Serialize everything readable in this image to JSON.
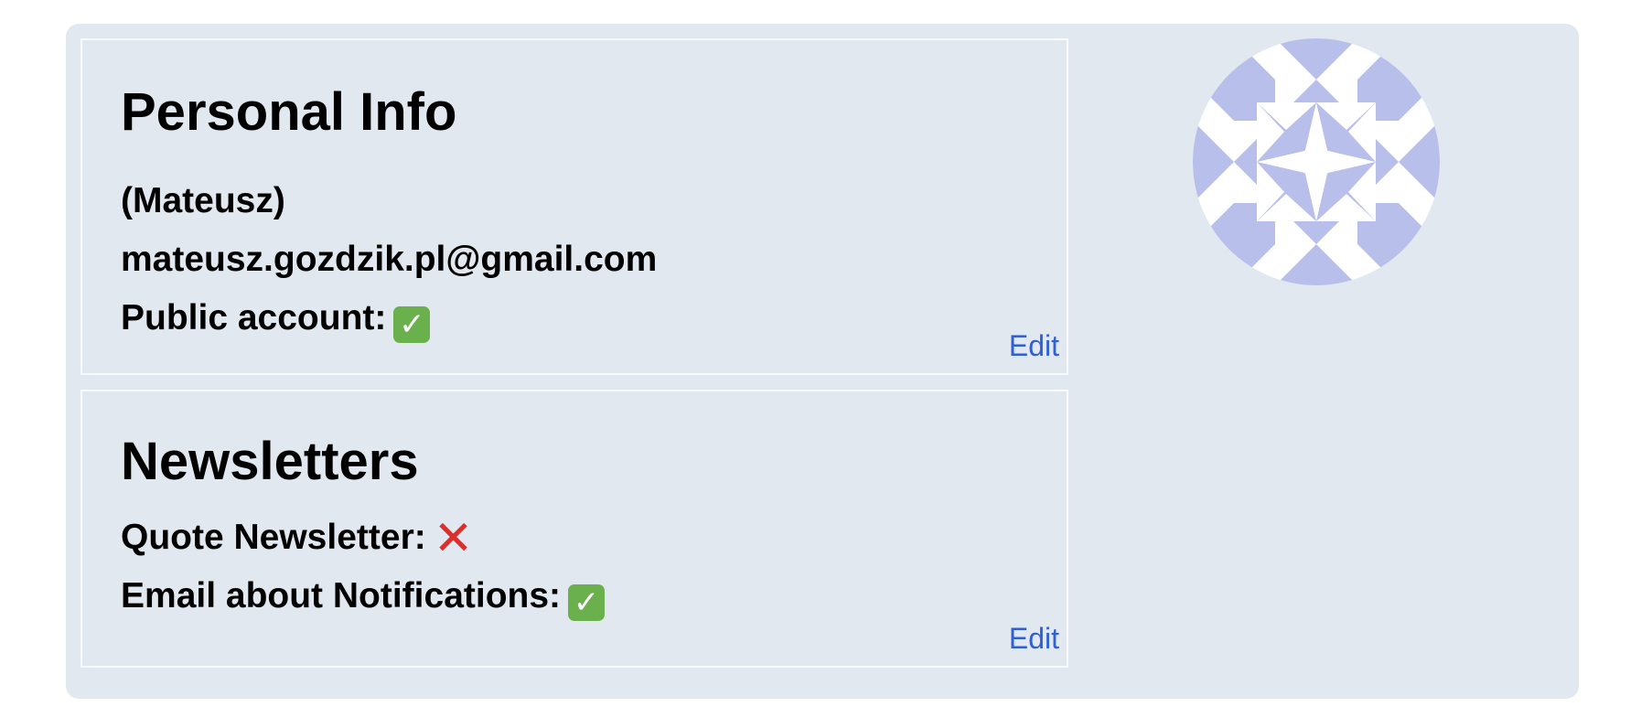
{
  "personal_info": {
    "heading": "Personal Info",
    "username": "(Mateusz)",
    "email": "mateusz.gozdzik.pl@gmail.com",
    "public_account_label": "Public account:",
    "public_account_value": "✓",
    "edit_label": "Edit"
  },
  "newsletters": {
    "heading": "Newsletters",
    "quote_newsletter_label": "Quote Newsletter:",
    "quote_newsletter_value": "✕",
    "notifications_label": "Email about Notifications:",
    "notifications_value": "✓",
    "edit_label": "Edit"
  },
  "avatar": {
    "icon": "identicon",
    "color": "#b8bfea",
    "background": "#ffffff"
  },
  "colors": {
    "panel_background": "#e2e8f0",
    "link": "#2f5fd4",
    "check_green": "#6ab04c",
    "cross_red": "#dd2e2e"
  }
}
